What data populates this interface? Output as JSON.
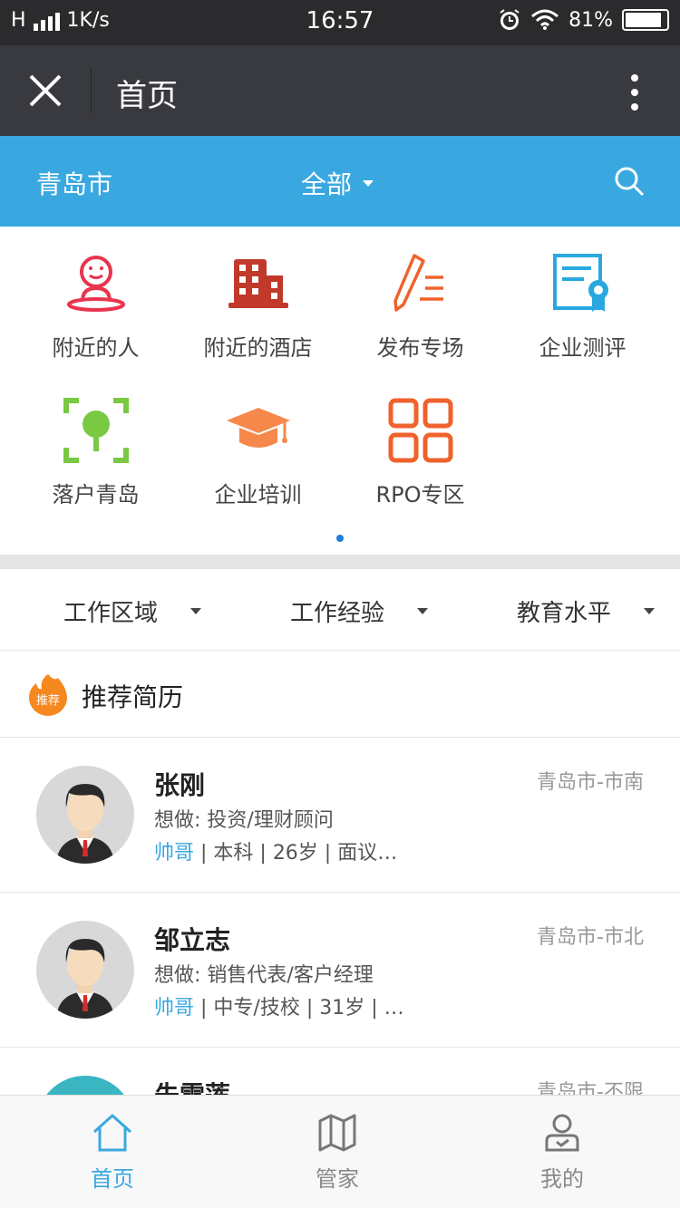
{
  "status_bar": {
    "network": "H",
    "speed": "1K/s",
    "time": "16:57",
    "battery": "81%"
  },
  "title_bar": {
    "title": "首页"
  },
  "location_bar": {
    "city": "青岛市",
    "category": "全部"
  },
  "quick_entries": [
    {
      "label": "附近的人",
      "icon": "nearby-person-icon",
      "color": "#e8344e"
    },
    {
      "label": "附近的酒店",
      "icon": "hotel-building-icon",
      "color": "#c0392b"
    },
    {
      "label": "发布专场",
      "icon": "pen-publish-icon",
      "color": "#f0622d"
    },
    {
      "label": "企业测评",
      "icon": "certificate-icon",
      "color": "#29a8e0"
    },
    {
      "label": "落户青岛",
      "icon": "tree-focus-icon",
      "color": "#7ac943"
    },
    {
      "label": "企业培训",
      "icon": "graduation-cap-icon",
      "color": "#f5884a"
    },
    {
      "label": "RPO专区",
      "icon": "grid-squares-icon",
      "color": "#f0622d"
    }
  ],
  "filters": [
    "工作区域",
    "工作经验",
    "教育水平"
  ],
  "recommend": {
    "badge": "推荐",
    "title": "推荐简历"
  },
  "resumes": [
    {
      "name": "张刚",
      "want_prefix": "想做: ",
      "want": "投资/理财顾问",
      "tag": "帅哥",
      "details": " | 本科 | 26岁 | 面议…",
      "location": "青岛市-市南"
    },
    {
      "name": "邹立志",
      "want_prefix": "想做: ",
      "want": "销售代表/客户经理",
      "tag": "帅哥",
      "details": " | 中专/技校 | 31岁 | …",
      "location": "青岛市-市北"
    },
    {
      "name": "朱雪莲",
      "want_prefix": "",
      "want": "",
      "tag": "",
      "details": "",
      "location": "青岛市-不限"
    }
  ],
  "tabs": [
    {
      "label": "首页",
      "icon": "home-icon",
      "active": true
    },
    {
      "label": "管家",
      "icon": "map-icon",
      "active": false
    },
    {
      "label": "我的",
      "icon": "profile-icon",
      "active": false
    }
  ],
  "colors": {
    "accent": "#3aa8e0",
    "title_bar": "#393a3f",
    "status_bar": "#2b2b2e"
  }
}
